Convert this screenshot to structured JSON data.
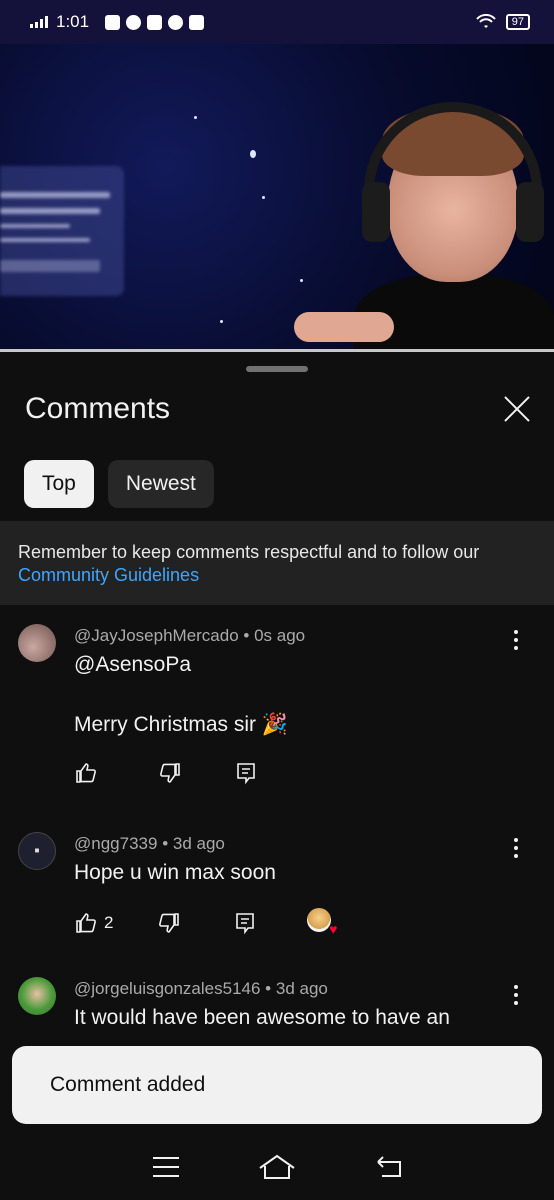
{
  "status_bar": {
    "time": "1:01",
    "battery": "97"
  },
  "comments_panel": {
    "title": "Comments",
    "tabs": [
      {
        "label": "Top",
        "active": true
      },
      {
        "label": "Newest",
        "active": false
      }
    ],
    "notice": {
      "text": "Remember to keep comments respectful and to follow our",
      "link": "Community Guidelines"
    },
    "comments": [
      {
        "author": "@JayJosephMercado",
        "time": "0s ago",
        "text": "@AsensoPa\n\nMerry Christmas sir 🎉",
        "likes": ""
      },
      {
        "author": "@ngg7339",
        "time": "3d ago",
        "text": "Hope u win max soon",
        "likes": "2"
      },
      {
        "author": "@jorgeluisgonzales5146",
        "time": "3d ago",
        "text": "It would have been awesome to have an",
        "likes": ""
      }
    ]
  },
  "toast": {
    "message": "Comment added"
  },
  "colors": {
    "background": "#0f0f0f",
    "link": "#3ea6ff",
    "status_bar": "#14123a"
  }
}
